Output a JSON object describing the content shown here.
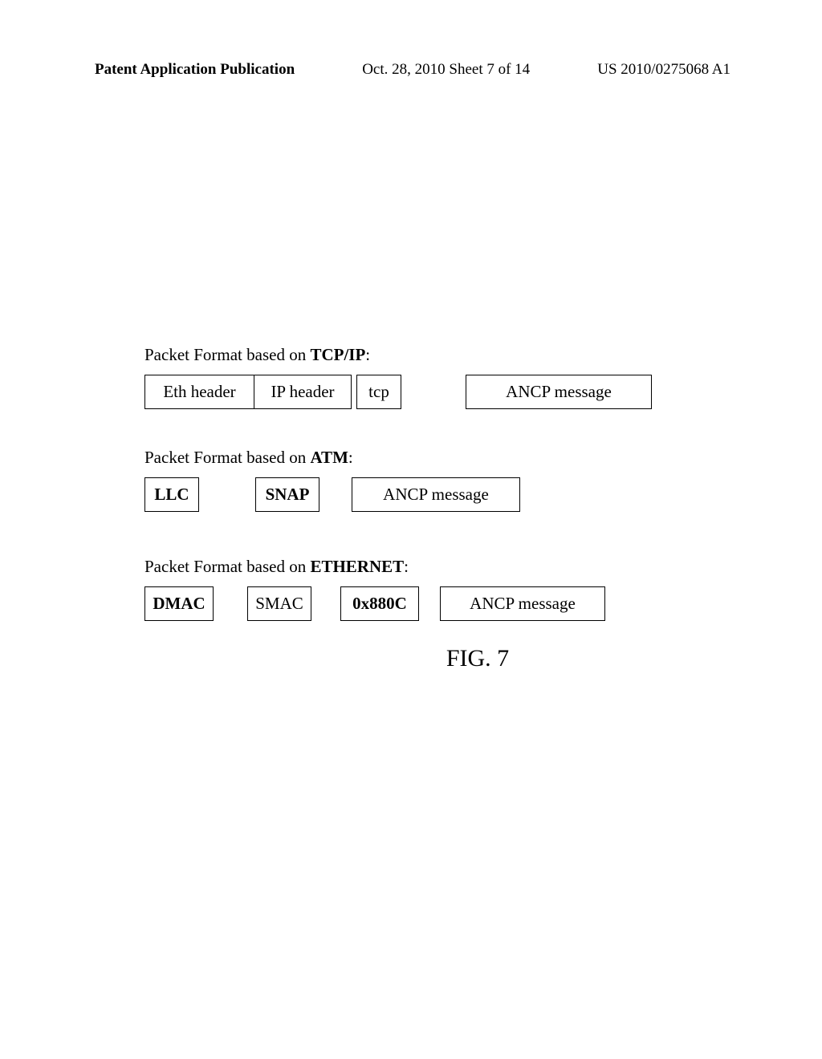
{
  "header": {
    "left": "Patent Application Publication",
    "center": "Oct. 28, 2010  Sheet 7 of 14",
    "right": "US 2010/0275068 A1"
  },
  "section1": {
    "label_prefix": "Packet Format based on ",
    "label_bold": "TCP/IP",
    "label_suffix": ":",
    "boxes": {
      "eth": "Eth header",
      "ip": "IP header",
      "tcp": "tcp",
      "ancp": "ANCP message"
    }
  },
  "section2": {
    "label_prefix": "Packet Format based on ",
    "label_bold": "ATM",
    "label_suffix": ":",
    "boxes": {
      "llc": "LLC",
      "snap": "SNAP",
      "ancp": "ANCP message"
    }
  },
  "section3": {
    "label_prefix": "Packet Format based on ",
    "label_bold": "ETHERNET",
    "label_suffix": ":",
    "boxes": {
      "dmac": "DMAC",
      "smac": "SMAC",
      "ethertype": "0x880C",
      "ancp": "ANCP message"
    }
  },
  "figure_label": "FIG. 7"
}
